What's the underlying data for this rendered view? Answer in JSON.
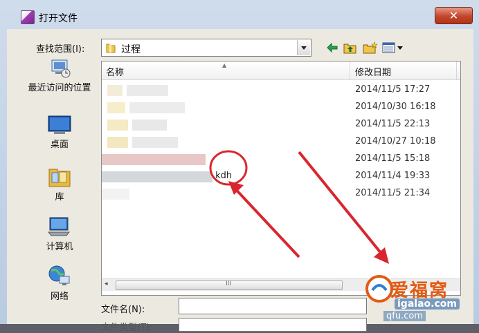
{
  "window": {
    "title": "打开文件",
    "close_glyph": "✕"
  },
  "toolbar": {
    "look_in_label": "查找范围(I):",
    "look_in_value": "过程"
  },
  "places": [
    {
      "label": "最近访问的位置",
      "icon": "recent-places-icon"
    },
    {
      "label": "桌面",
      "icon": "desktop-icon"
    },
    {
      "label": "库",
      "icon": "libraries-icon"
    },
    {
      "label": "计算机",
      "icon": "computer-icon"
    },
    {
      "label": "网络",
      "icon": "network-icon"
    }
  ],
  "file_list": {
    "columns": {
      "name": "名称",
      "date": "修改日期"
    },
    "rows": [
      {
        "name": "",
        "date": "2014/11/5 17:27",
        "type": "文"
      },
      {
        "name": "",
        "date": "2014/10/30 16:18",
        "type": "文"
      },
      {
        "name": "",
        "date": "2014/11/5 22:13",
        "type": "文"
      },
      {
        "name": "",
        "date": "2014/10/27 10:18",
        "type": "文"
      },
      {
        "name": "",
        "date": "2014/11/5 15:18",
        "type": "F"
      },
      {
        "name": ".kdh",
        "date": "2014/11/4 19:33",
        "type": "F"
      },
      {
        "name": "",
        "date": "2014/11/5 21:34",
        "type": "F"
      }
    ],
    "scroll_grip": "III"
  },
  "footer": {
    "file_name_label": "文件名(N):",
    "file_name_value": "",
    "file_type_label": "文件类型(T):"
  },
  "watermark": {
    "text": "爱福窝",
    "url": "igalao.com",
    "url2": "qfu.com"
  },
  "colors": {
    "annotation": "#d9262e",
    "title_bar": "#cfdcec",
    "close": "#c3452b"
  }
}
